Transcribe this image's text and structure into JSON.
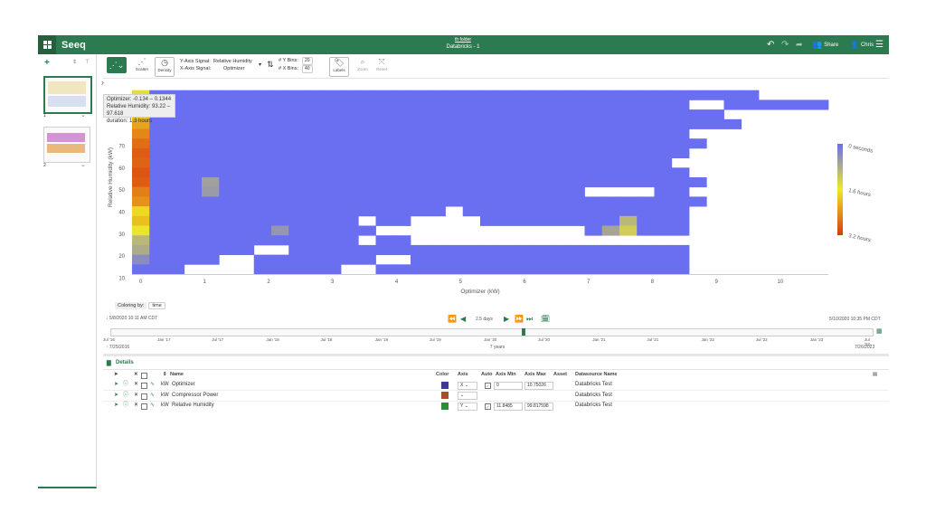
{
  "app": {
    "logo": "Seeq",
    "folder": "th folder",
    "title": "Databricks - 1",
    "share_label": "Share",
    "user_label": "Chris"
  },
  "toolbar": {
    "scatter_label": "Scatter",
    "density_label": "Density",
    "y_signal_label": "Y-Axis Signal:",
    "y_signal_value": "Relative Humidity",
    "x_signal_label": "X-Axis Signal:",
    "x_signal_value": "Optimizer",
    "y_bins_label": "# Y Bins:",
    "y_bins_value": "20",
    "x_bins_label": "# X Bins:",
    "x_bins_value": "40",
    "labels_label": "Labels",
    "zoom_label": "Zoom",
    "reset_label": "Reset"
  },
  "worksheets": [
    {
      "index": "1"
    },
    {
      "index": "2"
    }
  ],
  "tooltip": {
    "line1": "Optimizer: -0.134 – 0.1344",
    "line2": "Relative Humidity: 93.22 – 97.618",
    "line3": "duration: 1.3 hours"
  },
  "chart_data": {
    "type": "heatmap",
    "xlabel": "Optimizer (kW)",
    "ylabel": "Relative Humidity (kW)",
    "x_ticks": [
      0,
      1,
      2,
      3,
      4,
      5,
      6,
      7,
      8,
      9,
      10
    ],
    "y_ticks": [
      10,
      20,
      30,
      40,
      50,
      60,
      70
    ],
    "xlim": [
      -0.134,
      10.75
    ],
    "ylim": [
      11.85,
      99.82
    ],
    "colorbar": {
      "labels": [
        "0 seconds",
        "1.6 hours",
        "3.2 hours"
      ],
      "colors": [
        "#6a6ef0",
        "#f0ea24",
        "#d83a10"
      ]
    },
    "bins": {
      "x_count": 40,
      "y_count": 20
    },
    "hot_cells": [
      {
        "col": 0,
        "row": 19,
        "level": 0.42
      },
      {
        "col": 0,
        "row": 18,
        "level": 0.45
      },
      {
        "col": 0,
        "row": 17,
        "level": 0.48
      },
      {
        "col": 0,
        "row": 16,
        "level": 0.6
      },
      {
        "col": 0,
        "row": 15,
        "level": 0.7
      },
      {
        "col": 0,
        "row": 14,
        "level": 0.78
      },
      {
        "col": 0,
        "row": 13,
        "level": 0.85
      },
      {
        "col": 0,
        "row": 12,
        "level": 0.9
      },
      {
        "col": 0,
        "row": 11,
        "level": 0.88
      },
      {
        "col": 0,
        "row": 10,
        "level": 0.92
      },
      {
        "col": 0,
        "row": 9,
        "level": 0.9
      },
      {
        "col": 0,
        "row": 8,
        "level": 0.8
      },
      {
        "col": 0,
        "row": 7,
        "level": 0.75
      },
      {
        "col": 0,
        "row": 6,
        "level": 0.55
      },
      {
        "col": 0,
        "row": 5,
        "level": 0.62
      },
      {
        "col": 0,
        "row": 4,
        "level": 0.48
      },
      {
        "col": 0,
        "row": 3,
        "level": 0.3
      },
      {
        "col": 0,
        "row": 2,
        "level": 0.25
      },
      {
        "col": 0,
        "row": 1,
        "level": 0.12
      },
      {
        "col": 28,
        "row": 5,
        "level": 0.3
      },
      {
        "col": 28,
        "row": 4,
        "level": 0.38
      },
      {
        "col": 28,
        "row": 3,
        "level": 0.32
      },
      {
        "col": 27,
        "row": 4,
        "level": 0.22
      },
      {
        "col": 4,
        "row": 9,
        "level": 0.2
      },
      {
        "col": 4,
        "row": 8,
        "level": 0.18
      },
      {
        "col": 8,
        "row": 4,
        "level": 0.16
      }
    ],
    "mask": [
      [
        0,
        0,
        0,
        0,
        0,
        0,
        0,
        0,
        0,
        0,
        0,
        0,
        0,
        0,
        0,
        0,
        0,
        0,
        0,
        0,
        0,
        0,
        0,
        0,
        0,
        0,
        0,
        0,
        0,
        0,
        0,
        0,
        0,
        0,
        0,
        0,
        0,
        0,
        0,
        0
      ],
      [
        1,
        1,
        1,
        1,
        1,
        1,
        1,
        1,
        1,
        1,
        1,
        1,
        1,
        1,
        1,
        1,
        1,
        1,
        1,
        1,
        1,
        1,
        1,
        1,
        1,
        1,
        1,
        1,
        1,
        1,
        1,
        1,
        1,
        1,
        1,
        1,
        0,
        0,
        0,
        0
      ],
      [
        1,
        1,
        1,
        1,
        1,
        1,
        1,
        1,
        1,
        1,
        1,
        1,
        1,
        1,
        1,
        1,
        1,
        1,
        1,
        1,
        1,
        1,
        1,
        1,
        1,
        1,
        1,
        1,
        1,
        1,
        1,
        1,
        0,
        0,
        1,
        1,
        1,
        1,
        1,
        1
      ],
      [
        1,
        1,
        1,
        1,
        1,
        1,
        1,
        1,
        1,
        1,
        1,
        1,
        1,
        1,
        1,
        1,
        1,
        1,
        1,
        1,
        1,
        1,
        1,
        1,
        1,
        1,
        1,
        1,
        1,
        1,
        1,
        1,
        1,
        1,
        0,
        0,
        0,
        0,
        0,
        0
      ],
      [
        1,
        1,
        1,
        1,
        1,
        1,
        1,
        1,
        1,
        1,
        1,
        1,
        1,
        1,
        1,
        1,
        1,
        1,
        1,
        1,
        1,
        1,
        1,
        1,
        1,
        1,
        1,
        1,
        1,
        1,
        1,
        1,
        1,
        1,
        1,
        0,
        0,
        0,
        0,
        0
      ],
      [
        1,
        1,
        1,
        1,
        1,
        1,
        1,
        1,
        1,
        1,
        1,
        1,
        1,
        1,
        1,
        1,
        1,
        1,
        1,
        1,
        1,
        1,
        1,
        1,
        1,
        1,
        1,
        1,
        1,
        1,
        1,
        1,
        0,
        0,
        0,
        0,
        0,
        0,
        0,
        0
      ],
      [
        1,
        1,
        1,
        1,
        1,
        1,
        1,
        1,
        1,
        1,
        1,
        1,
        1,
        1,
        1,
        1,
        1,
        1,
        1,
        1,
        1,
        1,
        1,
        1,
        1,
        1,
        1,
        1,
        1,
        1,
        1,
        1,
        1,
        0,
        0,
        0,
        0,
        0,
        0,
        0
      ],
      [
        1,
        1,
        1,
        1,
        1,
        1,
        1,
        1,
        1,
        1,
        1,
        1,
        1,
        1,
        1,
        1,
        1,
        1,
        1,
        1,
        1,
        1,
        1,
        1,
        1,
        1,
        1,
        1,
        1,
        1,
        1,
        1,
        0,
        0,
        0,
        0,
        0,
        0,
        0,
        0
      ],
      [
        1,
        1,
        1,
        1,
        1,
        1,
        1,
        1,
        1,
        1,
        1,
        1,
        1,
        1,
        1,
        1,
        1,
        1,
        1,
        1,
        1,
        1,
        1,
        1,
        1,
        1,
        1,
        1,
        1,
        1,
        1,
        0,
        0,
        0,
        0,
        0,
        0,
        0,
        0,
        0
      ],
      [
        1,
        1,
        1,
        1,
        1,
        1,
        1,
        1,
        1,
        1,
        1,
        1,
        1,
        1,
        1,
        1,
        1,
        1,
        1,
        1,
        1,
        1,
        1,
        1,
        1,
        1,
        1,
        1,
        1,
        1,
        1,
        1,
        0,
        0,
        0,
        0,
        0,
        0,
        0,
        0
      ],
      [
        1,
        1,
        1,
        1,
        1,
        1,
        1,
        1,
        1,
        1,
        1,
        1,
        1,
        1,
        1,
        1,
        1,
        1,
        1,
        1,
        1,
        1,
        1,
        1,
        1,
        1,
        1,
        1,
        1,
        1,
        1,
        1,
        1,
        0,
        0,
        0,
        0,
        0,
        0,
        0
      ],
      [
        1,
        1,
        1,
        1,
        1,
        1,
        1,
        1,
        1,
        1,
        1,
        1,
        1,
        1,
        1,
        1,
        1,
        1,
        1,
        1,
        1,
        1,
        1,
        1,
        1,
        1,
        0,
        0,
        0,
        0,
        1,
        1,
        0,
        0,
        0,
        0,
        0,
        0,
        0,
        0
      ],
      [
        1,
        1,
        1,
        1,
        1,
        1,
        1,
        1,
        1,
        1,
        1,
        1,
        1,
        1,
        1,
        1,
        1,
        1,
        1,
        1,
        1,
        1,
        1,
        1,
        1,
        1,
        1,
        1,
        1,
        1,
        1,
        1,
        1,
        0,
        0,
        0,
        0,
        0,
        0,
        0
      ],
      [
        1,
        1,
        1,
        1,
        1,
        1,
        1,
        1,
        1,
        1,
        1,
        1,
        1,
        1,
        1,
        1,
        1,
        1,
        0,
        1,
        1,
        1,
        1,
        1,
        1,
        1,
        1,
        1,
        1,
        1,
        1,
        1,
        0,
        0,
        0,
        0,
        0,
        0,
        0,
        0
      ],
      [
        1,
        1,
        1,
        1,
        1,
        1,
        1,
        1,
        1,
        1,
        1,
        1,
        1,
        0,
        1,
        1,
        0,
        0,
        0,
        0,
        1,
        1,
        1,
        1,
        1,
        1,
        1,
        1,
        1,
        1,
        1,
        1,
        0,
        0,
        0,
        0,
        0,
        0,
        0,
        0
      ],
      [
        1,
        1,
        1,
        1,
        1,
        1,
        1,
        1,
        1,
        1,
        1,
        1,
        1,
        1,
        0,
        0,
        0,
        0,
        0,
        0,
        0,
        0,
        0,
        0,
        0,
        0,
        1,
        1,
        1,
        1,
        1,
        1,
        0,
        0,
        0,
        0,
        0,
        0,
        0,
        0
      ],
      [
        1,
        1,
        1,
        1,
        1,
        1,
        1,
        1,
        1,
        1,
        1,
        1,
        1,
        0,
        1,
        1,
        0,
        0,
        0,
        0,
        0,
        0,
        0,
        0,
        0,
        0,
        0,
        0,
        0,
        0,
        0,
        0,
        0,
        0,
        0,
        0,
        0,
        0,
        0,
        0
      ],
      [
        1,
        1,
        1,
        1,
        1,
        1,
        1,
        0,
        0,
        1,
        1,
        1,
        1,
        1,
        1,
        1,
        1,
        1,
        1,
        1,
        1,
        1,
        1,
        1,
        1,
        1,
        1,
        1,
        1,
        1,
        1,
        1,
        0,
        0,
        0,
        0,
        0,
        0,
        0,
        0
      ],
      [
        1,
        1,
        1,
        1,
        1,
        0,
        0,
        1,
        1,
        1,
        1,
        1,
        1,
        1,
        0,
        0,
        1,
        1,
        1,
        1,
        1,
        1,
        1,
        1,
        1,
        1,
        1,
        1,
        1,
        1,
        1,
        1,
        0,
        0,
        0,
        0,
        0,
        0,
        0,
        0
      ],
      [
        1,
        1,
        1,
        0,
        0,
        0,
        0,
        1,
        1,
        1,
        1,
        1,
        0,
        0,
        1,
        1,
        1,
        1,
        1,
        1,
        1,
        1,
        1,
        1,
        1,
        1,
        1,
        1,
        1,
        1,
        1,
        1,
        0,
        0,
        0,
        0,
        0,
        0,
        0,
        0
      ]
    ]
  },
  "coloring": {
    "label": "Coloring by:",
    "value": "time"
  },
  "timebar": {
    "start": "5/8/2020 10:11 AM  CDT",
    "end": "5/10/2020 10:35 PM  CDT",
    "duration": "2.5 days",
    "range_start": "7/25/2016",
    "range_end": "7/26/2023",
    "range_span": "7 years",
    "ticks": [
      "Jul '16",
      "Jan '17",
      "Jul '17",
      "Jan '18",
      "Jul '18",
      "Jan '19",
      "Jul '19",
      "Jan '20",
      "Jul '20",
      "Jan '21",
      "Jul '21",
      "Jan '22",
      "Jul '22",
      "Jan '23",
      "Jul '23"
    ]
  },
  "details": {
    "title": "Details",
    "headers": {
      "name": "Name",
      "color": "Color",
      "axis": "Axis",
      "auto": "Auto",
      "axis_min": "Axis Min",
      "axis_max": "Axis Max",
      "asset": "Asset",
      "datasource": "Datasource Name"
    },
    "rows": [
      {
        "unit": "kW",
        "name": "Optimizer",
        "color": "#3e3a9a",
        "axis": "X",
        "axis_min": "0",
        "axis_max": "10.75026",
        "datasource": "Databricks Test"
      },
      {
        "unit": "kW",
        "name": "Compressor Power",
        "color": "#a0522d",
        "axis": "",
        "axis_min": "",
        "axis_max": "",
        "datasource": "Databricks Test"
      },
      {
        "unit": "kW",
        "name": "Relative Humidity",
        "color": "#2e8b3a",
        "axis": "Y",
        "axis_min": "11.8485",
        "axis_max": "99.817598",
        "datasource": "Databricks Test"
      }
    ]
  }
}
